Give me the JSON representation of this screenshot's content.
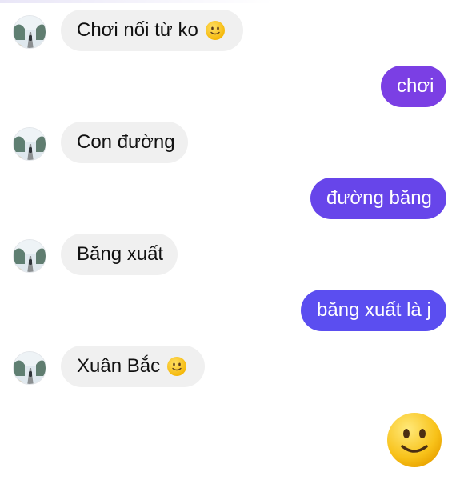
{
  "colors": {
    "incoming_bubble": "#f0f0f0",
    "outgoing_bubble_start": "#7b3fe4",
    "outgoing_bubble_end": "#5b4ef0"
  },
  "messages": [
    {
      "sender": "other",
      "text": "Chơi nối từ ko",
      "emoji": "slightly-smiling-face-icon"
    },
    {
      "sender": "me",
      "text": "chơi"
    },
    {
      "sender": "other",
      "text": "Con đường"
    },
    {
      "sender": "me",
      "text": "đường băng"
    },
    {
      "sender": "other",
      "text": "Băng xuất"
    },
    {
      "sender": "me",
      "text": "băng xuất là j"
    },
    {
      "sender": "other",
      "text": "Xuân Bắc",
      "emoji": "slightly-smiling-face-icon"
    },
    {
      "sender": "me",
      "text": "",
      "emoji": "large-slightly-smiling-face-icon"
    }
  ]
}
